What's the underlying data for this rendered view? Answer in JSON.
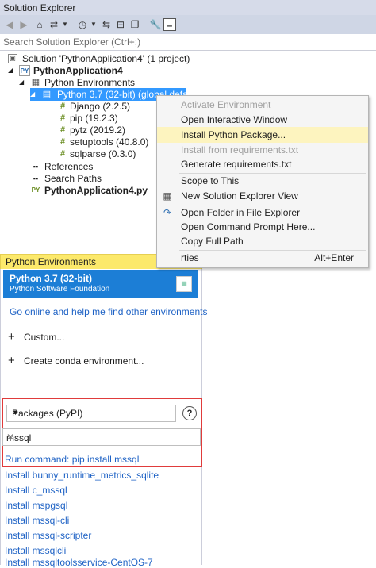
{
  "solution_explorer": {
    "title": "Solution Explorer",
    "search_placeholder": "Search Solution Explorer (Ctrl+;)",
    "tree": {
      "solution": "Solution 'PythonApplication4' (1 project)",
      "project": "PythonApplication4",
      "python_envs": "Python Environments",
      "env": "Python 3.7 (32-bit) (global default)",
      "packages": [
        "Django (2.2.5)",
        "pip (19.2.3)",
        "pytz (2019.2)",
        "setuptools (40.8.0)",
        "sqlparse (0.3.0)"
      ],
      "references": "References",
      "search_paths": "Search Paths",
      "file": "PythonApplication4.py"
    }
  },
  "context_menu": {
    "items": [
      {
        "label": "Activate Environment"
      },
      {
        "label": "Open Interactive Window"
      },
      {
        "label": "Install Python Package..."
      },
      {
        "label": "Install from requirements.txt"
      },
      {
        "label": "Generate requirements.txt"
      },
      {
        "label": "Scope to This"
      },
      {
        "label": "New Solution Explorer View"
      },
      {
        "label": "Open Folder in File Explorer"
      },
      {
        "label": "Open Command Prompt Here..."
      },
      {
        "label": "Copy Full Path"
      },
      {
        "label": "rties",
        "shortcut": "Alt+Enter"
      }
    ]
  },
  "python_environments": {
    "title": "Python Environments",
    "selected_env": {
      "name": "Python 3.7 (32-bit)",
      "publisher": "Python Software Foundation"
    },
    "online_link": "Go online and help me find other environments",
    "custom": "Custom...",
    "create_conda": "Create conda environment...",
    "packages_dropdown": "Packages (PyPI)",
    "search_value": "mssql",
    "run_command": "Run command: pip install mssql",
    "results": [
      "Install bunny_runtime_metrics_sqlite",
      "Install c_mssql",
      "Install mspgsql",
      "Install mssql-cli",
      "Install mssql-scripter",
      "Install mssqlcli",
      "Install mssqltoolsservice-CentOS-7"
    ]
  },
  "colors": {
    "accent": "#1c7ed6",
    "selection": "#3399ff",
    "tool_window_title": "#fce96b",
    "highlight_box": "#e03b3b"
  }
}
